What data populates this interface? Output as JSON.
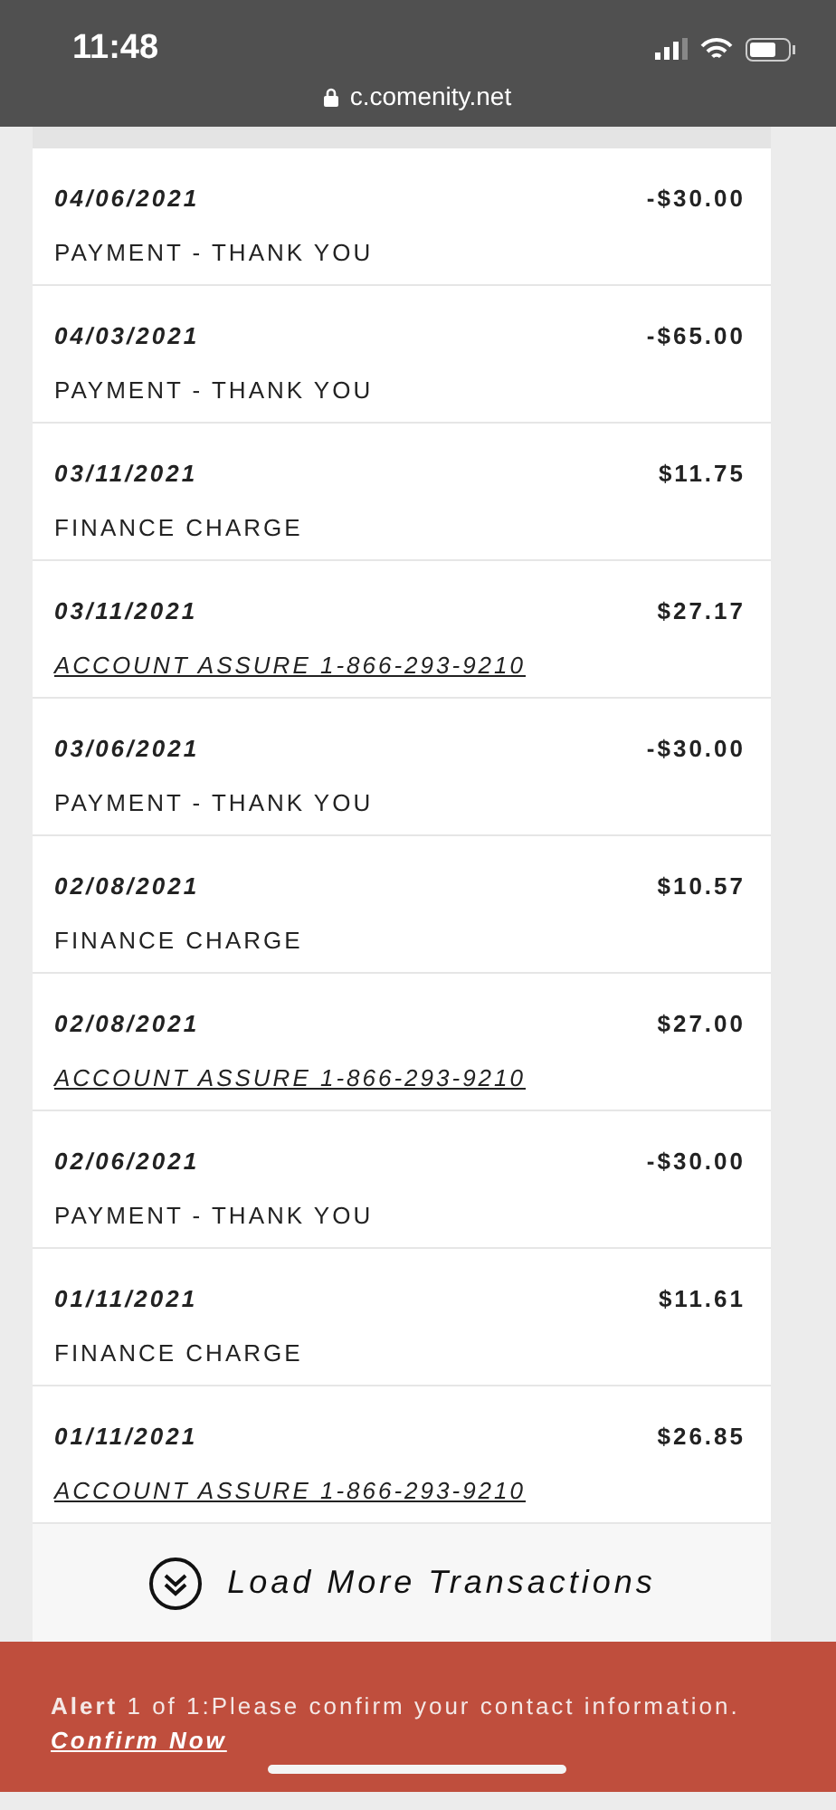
{
  "status_bar": {
    "time": "11:48",
    "url": "c.comenity.net"
  },
  "transactions": [
    {
      "date": "04/06/2021",
      "amount": "-$30.00",
      "description": "PAYMENT - THANK YOU",
      "kind": "plain"
    },
    {
      "date": "04/03/2021",
      "amount": "-$65.00",
      "description": "PAYMENT - THANK YOU",
      "kind": "plain"
    },
    {
      "date": "03/11/2021",
      "amount": "$11.75",
      "description": "FINANCE CHARGE",
      "kind": "plain"
    },
    {
      "date": "03/11/2021",
      "amount": "$27.17",
      "description": "ACCOUNT ASSURE 1-866-293-9210",
      "kind": "link"
    },
    {
      "date": "03/06/2021",
      "amount": "-$30.00",
      "description": "PAYMENT - THANK YOU",
      "kind": "plain"
    },
    {
      "date": "02/08/2021",
      "amount": "$10.57",
      "description": "FINANCE CHARGE",
      "kind": "plain"
    },
    {
      "date": "02/08/2021",
      "amount": "$27.00",
      "description": "ACCOUNT ASSURE 1-866-293-9210",
      "kind": "link"
    },
    {
      "date": "02/06/2021",
      "amount": "-$30.00",
      "description": "PAYMENT - THANK YOU",
      "kind": "plain"
    },
    {
      "date": "01/11/2021",
      "amount": "$11.61",
      "description": "FINANCE CHARGE",
      "kind": "plain"
    },
    {
      "date": "01/11/2021",
      "amount": "$26.85",
      "description": "ACCOUNT ASSURE 1-866-293-9210",
      "kind": "link"
    }
  ],
  "load_more": {
    "label": "Load More Transactions"
  },
  "alert": {
    "message": "**Alert** 1 of 1:Please confirm your contact information.",
    "link": "Confirm Now"
  }
}
